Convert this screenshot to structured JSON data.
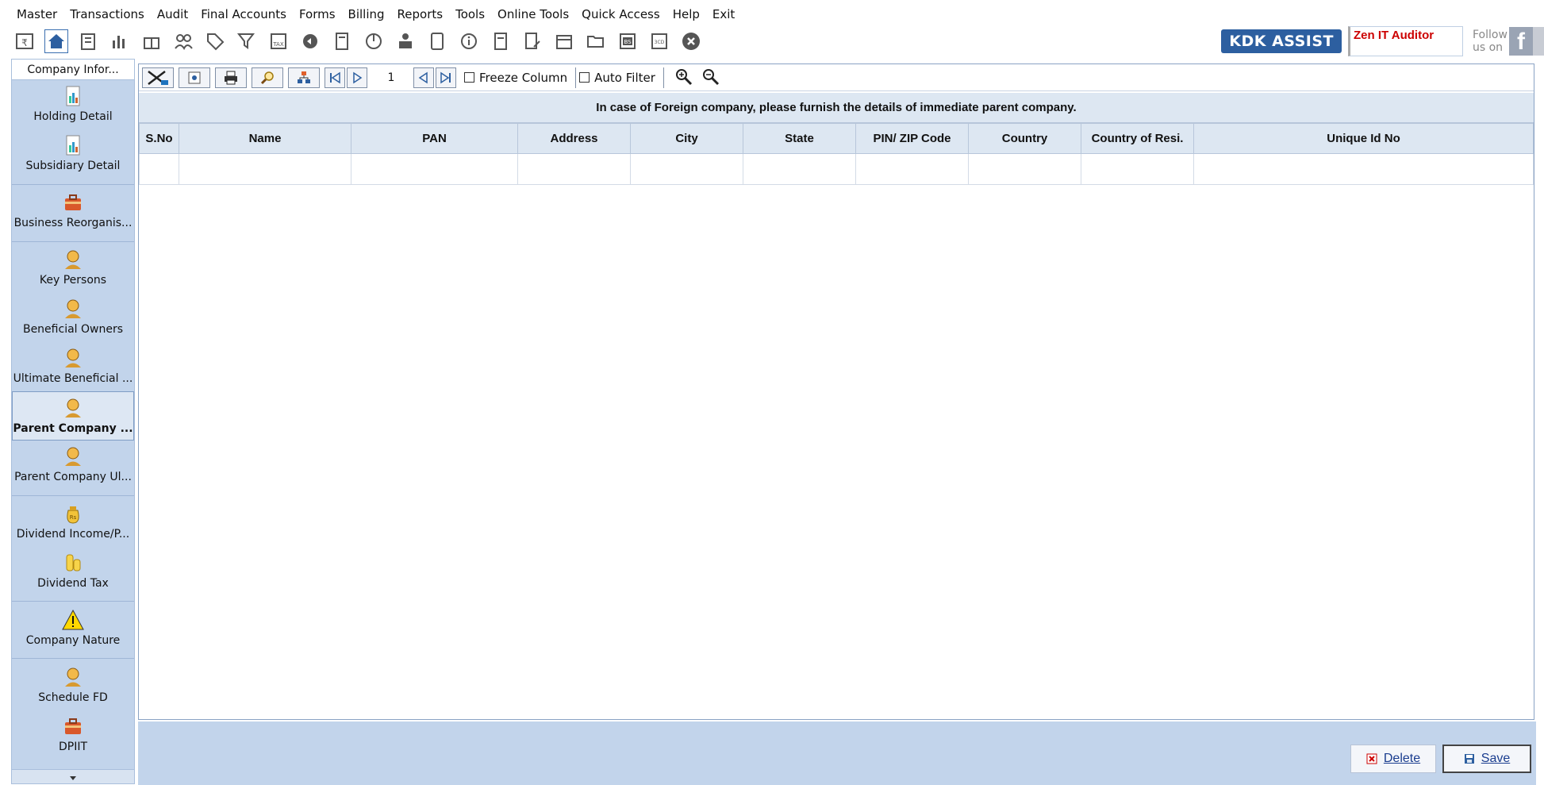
{
  "menu": [
    "Master",
    "Transactions",
    "Audit",
    "Final Accounts",
    "Forms",
    "Billing",
    "Reports",
    "Tools",
    "Online Tools",
    "Quick Access",
    "Help",
    "Exit"
  ],
  "brand": {
    "kdk": "KDK ASSIST",
    "zen": "Zen IT Auditor",
    "follow": "Follow us on"
  },
  "sidebar": {
    "header": "Company Infor...",
    "items": [
      {
        "label": "Holding Detail"
      },
      {
        "label": "Subsidiary Detail"
      },
      {
        "label": "Business Reorganis..."
      },
      {
        "label": "Key Persons"
      },
      {
        "label": "Beneficial Owners"
      },
      {
        "label": "Ultimate Beneficial ..."
      },
      {
        "label": "Parent Company ..."
      },
      {
        "label": "Parent Company Ul..."
      },
      {
        "label": "Dividend Income/P..."
      },
      {
        "label": "Dividend Tax"
      },
      {
        "label": "Company Nature"
      },
      {
        "label": "Schedule FD"
      },
      {
        "label": "DPIIT"
      }
    ]
  },
  "grid_toolbar": {
    "page": "1",
    "freeze": "Freeze Column",
    "autofilter": "Auto Filter"
  },
  "banner": "In case of Foreign company, please furnish the details of immediate parent company.",
  "columns": [
    "S.No",
    "Name",
    "PAN",
    "Address",
    "City",
    "State",
    "PIN/ ZIP Code",
    "Country",
    "Country of Resi.",
    "Unique Id No"
  ],
  "footer": {
    "delete": "Delete",
    "save": "Save"
  },
  "colors": {
    "accent": "#2d5fa0",
    "panel": "#c2d4eb",
    "header": "#dde7f2"
  }
}
